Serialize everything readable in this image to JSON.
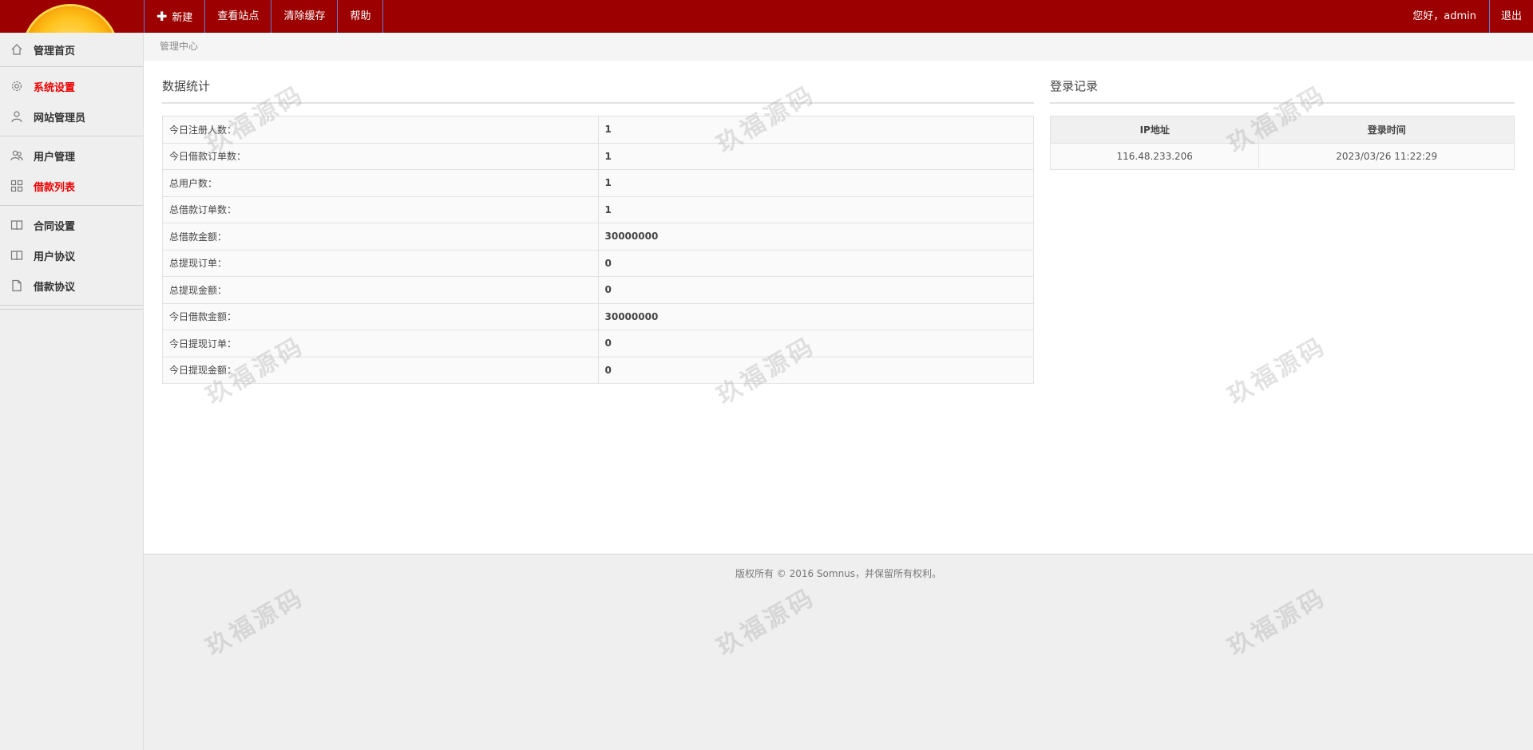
{
  "topbar": {
    "nav": [
      {
        "label": "新建",
        "icon": "plus-icon"
      },
      {
        "label": "查看站点"
      },
      {
        "label": "清除缓存"
      },
      {
        "label": "帮助"
      }
    ],
    "greeting": "您好，admin",
    "logout": "退出"
  },
  "sidebar": {
    "items": [
      {
        "label": "管理首页",
        "icon": "home-icon",
        "active": false
      },
      {
        "label": "系统设置",
        "icon": "gear-icon",
        "active": true
      },
      {
        "label": "网站管理员",
        "icon": "user-icon",
        "active": false
      },
      {
        "label": "用户管理",
        "icon": "users-icon",
        "active": false
      },
      {
        "label": "借款列表",
        "icon": "grid-icon",
        "active": true
      },
      {
        "label": "合同设置",
        "icon": "book-icon",
        "active": false
      },
      {
        "label": "用户协议",
        "icon": "book-icon",
        "active": false
      },
      {
        "label": "借款协议",
        "icon": "file-icon",
        "active": false
      }
    ]
  },
  "breadcrumb": "管理中心",
  "stats": {
    "title": "数据统计",
    "rows": [
      {
        "label": "今日注册人数：",
        "value": "1"
      },
      {
        "label": "今日借款订单数：",
        "value": "1"
      },
      {
        "label": "总用户数：",
        "value": "1"
      },
      {
        "label": "总借款订单数：",
        "value": "1"
      },
      {
        "label": "总借款金额：",
        "value": "30000000"
      },
      {
        "label": "总提现订单：",
        "value": "0"
      },
      {
        "label": "总提现金额：",
        "value": "0"
      },
      {
        "label": "今日借款金额：",
        "value": "30000000"
      },
      {
        "label": "今日提现订单：",
        "value": "0"
      },
      {
        "label": "今日提现金额：",
        "value": "0"
      }
    ]
  },
  "logins": {
    "title": "登录记录",
    "headers": [
      "IP地址",
      "登录时间"
    ],
    "rows": [
      {
        "ip": "116.48.233.206",
        "time": "2023/03/26 11:22:29"
      }
    ]
  },
  "footer": "版权所有 © 2016 Somnus，并保留所有权利。",
  "watermark": "玖福源码",
  "colors": {
    "header": "#9c0000",
    "active": "#e00000"
  }
}
